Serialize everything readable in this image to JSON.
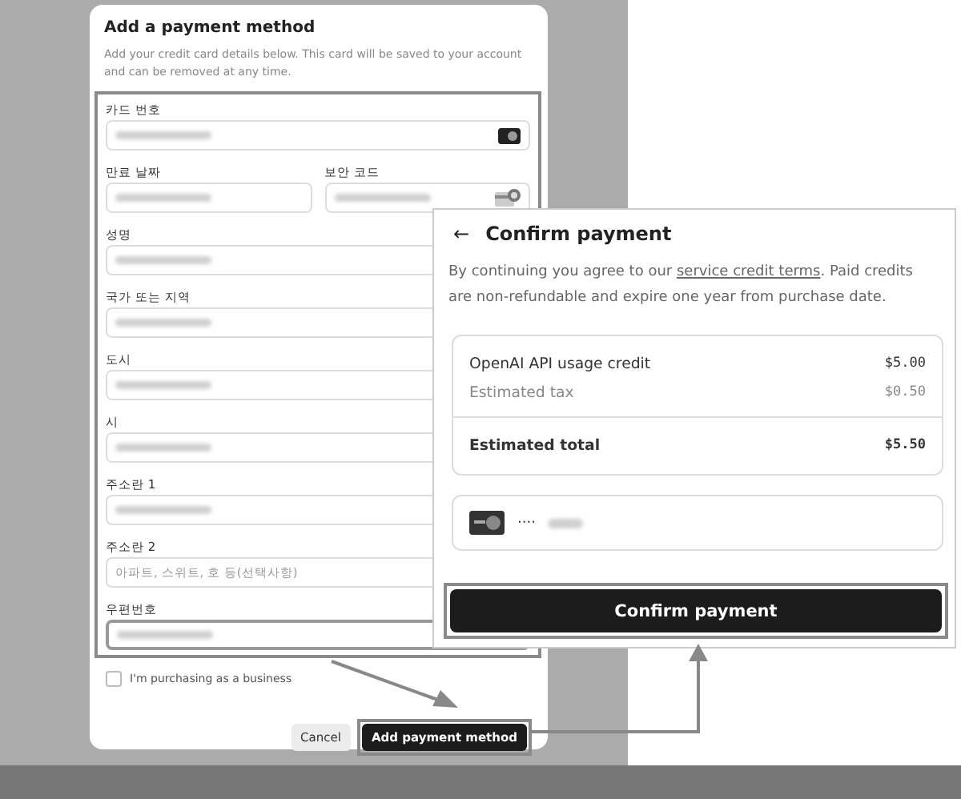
{
  "add_payment_dialog": {
    "title": "Add a payment method",
    "description": "Add your credit card details below. This card will be saved to your account and can be removed at any time.",
    "form_rows": [
      [
        {
          "label": "카드 번호",
          "redacted": true,
          "kind": "card_number"
        }
      ],
      [
        {
          "label": "만료 날짜",
          "redacted": true
        },
        {
          "label": "보안 코드",
          "redacted": true,
          "kind": "security_code"
        }
      ],
      [
        {
          "label": "성명",
          "redacted": true
        }
      ],
      [
        {
          "label": "국가 또는 지역",
          "redacted": true
        }
      ],
      [
        {
          "label": "도시",
          "redacted": true
        }
      ],
      [
        {
          "label": "시",
          "redacted": true
        }
      ],
      [
        {
          "label": "주소란 1",
          "redacted": true
        }
      ],
      [
        {
          "label": "주소란 2",
          "placeholder": "아파트, 스위트, 호 등(선택사항)"
        }
      ],
      [
        {
          "label": "우편번호",
          "redacted": true,
          "focused": true
        }
      ]
    ],
    "business_checkbox": {
      "label": "I'm purchasing as a business",
      "checked": false
    },
    "buttons": [
      {
        "label": "Cancel",
        "kind": "secondary"
      },
      {
        "label": "Add payment method",
        "kind": "primary"
      }
    ]
  },
  "confirm_panel": {
    "back": "←",
    "title": "Confirm payment",
    "terms": {
      "before": "By continuing you agree to our",
      "link": "service credit terms",
      "after": ". Paid credits are non-refundable and expire one year from purchase date."
    },
    "lines": [
      {
        "label": "OpenAI API usage credit",
        "amount": "$5.00",
        "kind": "item"
      },
      {
        "label": "Estimated tax",
        "amount": "$0.50",
        "kind": "muted"
      },
      {
        "label": "Estimated total",
        "amount": "$5.50",
        "kind": "total"
      }
    ],
    "payment_method": {
      "masked": "····",
      "redacted": true
    },
    "button": {
      "label": "Confirm payment"
    }
  }
}
